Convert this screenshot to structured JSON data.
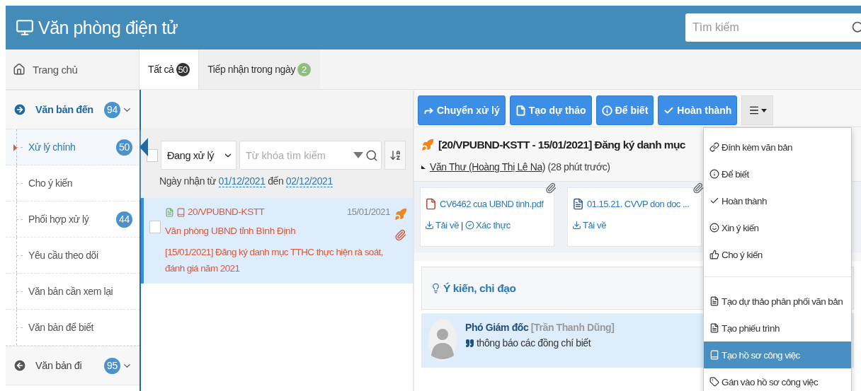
{
  "header": {
    "title": "Văn phòng điện tử",
    "search_placeholder": "Tìm kiếm"
  },
  "home": "Trang chủ",
  "tabs": [
    {
      "label": "Tất cả",
      "count": "50",
      "color": "#333333",
      "selected": true
    },
    {
      "label": "Tiếp nhận trong ngày",
      "count": "2",
      "color": "#8fbf7f",
      "selected": false
    }
  ],
  "sidebar": [
    {
      "kind": "incoming",
      "label": "Văn bản đến",
      "count": "94",
      "expanded": true,
      "children": [
        {
          "label": "Xử lý chính",
          "count": "50",
          "selected": true
        },
        {
          "label": "Cho ý kiến",
          "selected": false
        },
        {
          "label": "Phối hợp xử lý",
          "count": "44",
          "selected": false
        },
        {
          "label": "Yêu cầu theo dõi",
          "selected": false
        },
        {
          "label": "Văn bản cần xem lại",
          "selected": false
        },
        {
          "label": "Văn bản để biết",
          "selected": false
        }
      ]
    },
    {
      "kind": "outgoing",
      "label": "Văn bản đi",
      "count": "95",
      "expanded": false
    }
  ],
  "list": {
    "select_all_checked": false,
    "filter": "Đang xử lý",
    "search_placeholder": "Từ khóa tìm kiếm",
    "date_label": "Ngày nhận từ",
    "date_from": "01/12/2021",
    "date_mid": "đến",
    "date_to": "02/12/2021",
    "items": [
      {
        "number": "20/VPUBND-KSTT",
        "date": "15/01/2021",
        "sender": "Văn phòng UBND tỉnh Bình Định",
        "summary": "[15/01/2021] Đăng ký danh mục TTHC thực hiện rà soát, đánh giá năm 2021",
        "selected": true,
        "checked": false
      }
    ]
  },
  "actions": [
    {
      "kind": "forward",
      "label": "Chuyển xử lý"
    },
    {
      "kind": "file",
      "label": "Tạo dự thảo"
    },
    {
      "kind": "info",
      "label": "Để biết"
    },
    {
      "kind": "check",
      "label": "Hoàn thành"
    }
  ],
  "document": {
    "title": "[20/VPUBND-KSTT - 15/01/2021] Đăng ký danh mục",
    "sender": "Văn Thư (Hoàng Thị Lê Na)",
    "time": "(28 phút trước)",
    "separator": "|",
    "attachments": [
      {
        "kind": "pdf",
        "name": "CV6462 cua UBND tinh.pdf",
        "links": [
          "Tải về",
          "Xác thực"
        ]
      },
      {
        "kind": "word",
        "name": "01.15.21. CVVP don doc ...",
        "links": [
          "Tải về"
        ]
      }
    ]
  },
  "opinions": {
    "title": "Ý kiến, chỉ đạo",
    "comments": [
      {
        "role": "Phó Giám đốc",
        "name": "[Trần Thanh Dũng]",
        "text": "thông báo các đồng chí biết"
      }
    ]
  },
  "menu": [
    [
      {
        "kind": "link",
        "label": "Đính kèm văn bản",
        "selected": false
      },
      {
        "kind": "info",
        "label": "Để biết",
        "selected": false
      },
      {
        "kind": "check",
        "label": "Hoàn thành",
        "selected": false
      },
      {
        "kind": "smile",
        "label": "Xin ý kiến",
        "selected": false
      },
      {
        "kind": "thumb",
        "label": "Cho ý kiến",
        "selected": false
      }
    ],
    [
      {
        "kind": "file",
        "label": "Tạo dự thảo phân phối văn bản",
        "selected": false
      },
      {
        "kind": "file",
        "label": "Tạo phiếu trình",
        "selected": false
      },
      {
        "kind": "book",
        "label": "Tạo hồ sơ công việc",
        "selected": true
      },
      {
        "kind": "tag",
        "label": "Gán vào hồ sơ công việc",
        "selected": false
      }
    ]
  ]
}
